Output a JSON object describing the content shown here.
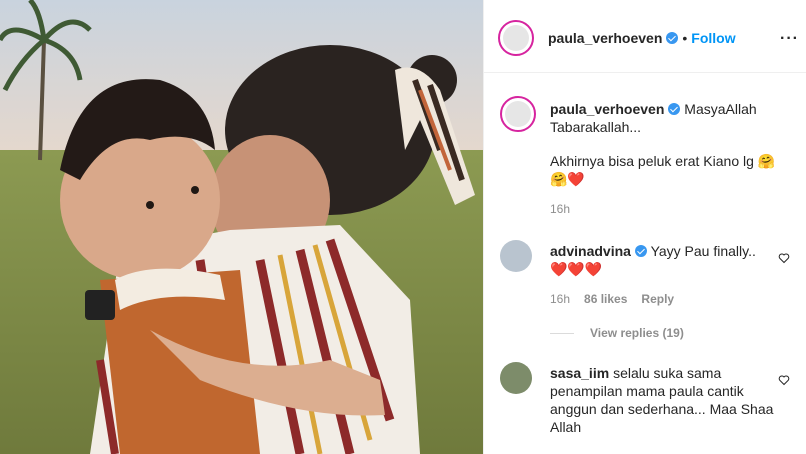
{
  "post": {
    "author": "paula_verhoeven",
    "follow_label": "Follow",
    "separator": "•",
    "more_label": "···",
    "caption_line1": "MasyaAllah Tabarakallah...",
    "caption_line2": "Akhirnya bisa peluk erat Kiano lg 🤗",
    "caption_line3": "🤗❤️",
    "caption_time": "16h"
  },
  "comments": [
    {
      "user": "advinadvina",
      "verified": true,
      "text": "Yayy Pau finally..",
      "text_line2": "❤️❤️❤️",
      "time": "16h",
      "likes": "86 likes",
      "reply_label": "Reply",
      "view_replies": "View replies (19)"
    },
    {
      "user": "sasa_iim",
      "verified": false,
      "text": "selalu suka sama penampilan mama paula cantik anggun dan sederhana... Maa Shaa Allah"
    }
  ],
  "colors": {
    "accent": "#0095f6",
    "verified": "#3897f0",
    "story_ring": "#d6249f"
  },
  "icons": [
    "verified-badge-icon",
    "more-options-icon",
    "heart-icon"
  ]
}
